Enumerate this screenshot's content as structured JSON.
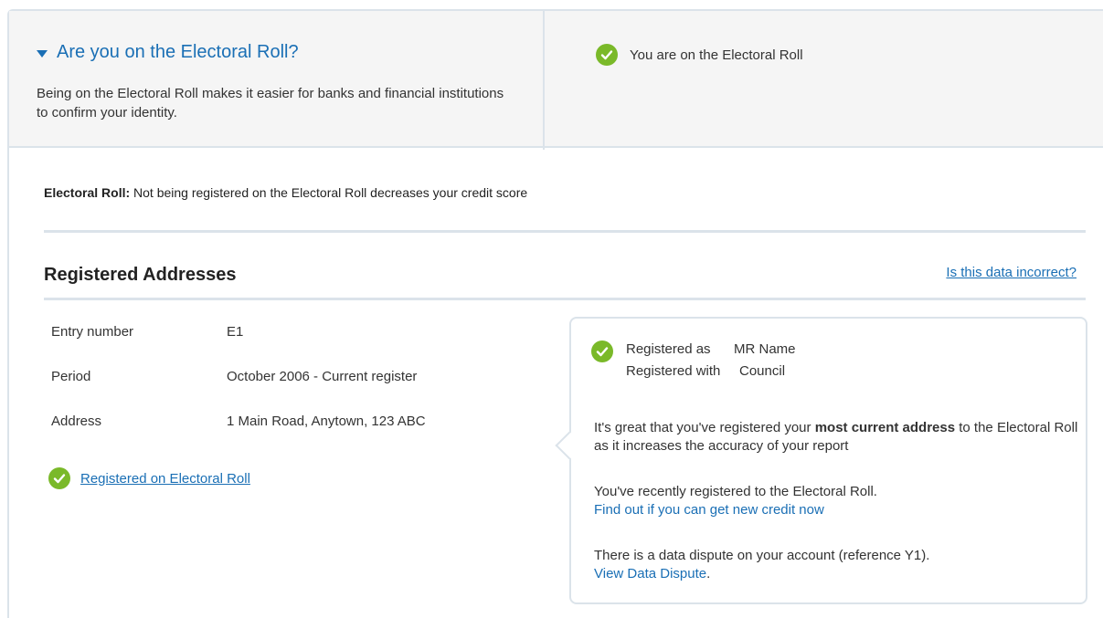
{
  "summary": {
    "toggle_title": "Are you on the Electoral Roll?",
    "description": "Being on the Electoral Roll makes it easier for banks and financial institutions to confirm your identity.",
    "status": "You are on the Electoral Roll"
  },
  "notice": {
    "label": "Electoral Roll:",
    "text": " Not being registered on the Electoral Roll decreases your credit score"
  },
  "section": {
    "title": "Registered Addresses",
    "incorrect_link": "Is this data incorrect?"
  },
  "entry": {
    "entry_number_label": "Entry number",
    "entry_number": "E1",
    "period_label": "Period",
    "period": "October 2006 - Current register",
    "address_label": "Address",
    "address": "1 Main Road, Anytown, 123 ABC",
    "registered_link": "Registered on Electoral Roll"
  },
  "card": {
    "registered_as_label": "Registered as",
    "registered_as": "MR Name",
    "registered_with_label": "Registered with",
    "registered_with": "Council",
    "p1_prefix": "It's great that you've registered your ",
    "p1_bold": "most current address",
    "p1_suffix": " to the Electoral Roll as it increases the accuracy of your report",
    "p2_text": "You've recently registered to the Electoral Roll.",
    "p2_link": "Find out if you can get new credit now",
    "p3_text": "There is a data dispute on your account (reference Y1).",
    "p3_link": "View Data Dispute",
    "p3_period": "."
  },
  "colors": {
    "accent": "#1a6fb5",
    "success": "#7ab929",
    "divider": "#dbe3ea",
    "band": "#f5f5f5"
  }
}
